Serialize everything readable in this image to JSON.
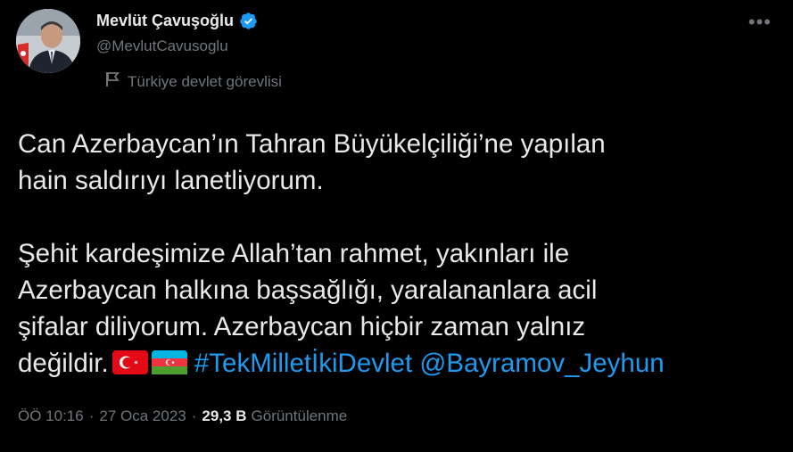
{
  "author": {
    "name": "Mevlüt Çavuşoğlu",
    "handle": "@MevlutCavusoglu",
    "verified": true,
    "affiliation_label": "Türkiye devlet görevlisi",
    "avatar_icon": "person-avatar"
  },
  "tweet": {
    "line1": "Can Azerbaycan’ın Tahran Büyükelçiliği’ne yapılan",
    "line2": "hain saldırıyı lanetliyorum.",
    "line3": "Şehit kardeşimize Allah’tan rahmet, yakınları ile",
    "line4": "Azerbaycan halkına başsağlığı, yaralananlara acil",
    "line5": "şifalar diliyorum. Azerbaycan hiçbir zaman yalnız",
    "line6_start": "değildir.",
    "hashtag": "#TekMilletİkiDevlet",
    "mention": "@Bayramov_Jeyhun",
    "flags": [
      "turkey-flag-icon",
      "azerbaijan-flag-icon"
    ]
  },
  "meta": {
    "time": "ÖÖ 10:16",
    "separator": "·",
    "date": "27 Oca 2023",
    "views_count": "29,3 B",
    "views_label": "Görüntülenme"
  },
  "colors": {
    "background": "#000000",
    "text": "#e7e9ea",
    "secondary": "#71767b",
    "link": "#1d9bf0",
    "verified": "#1d9bf0"
  }
}
